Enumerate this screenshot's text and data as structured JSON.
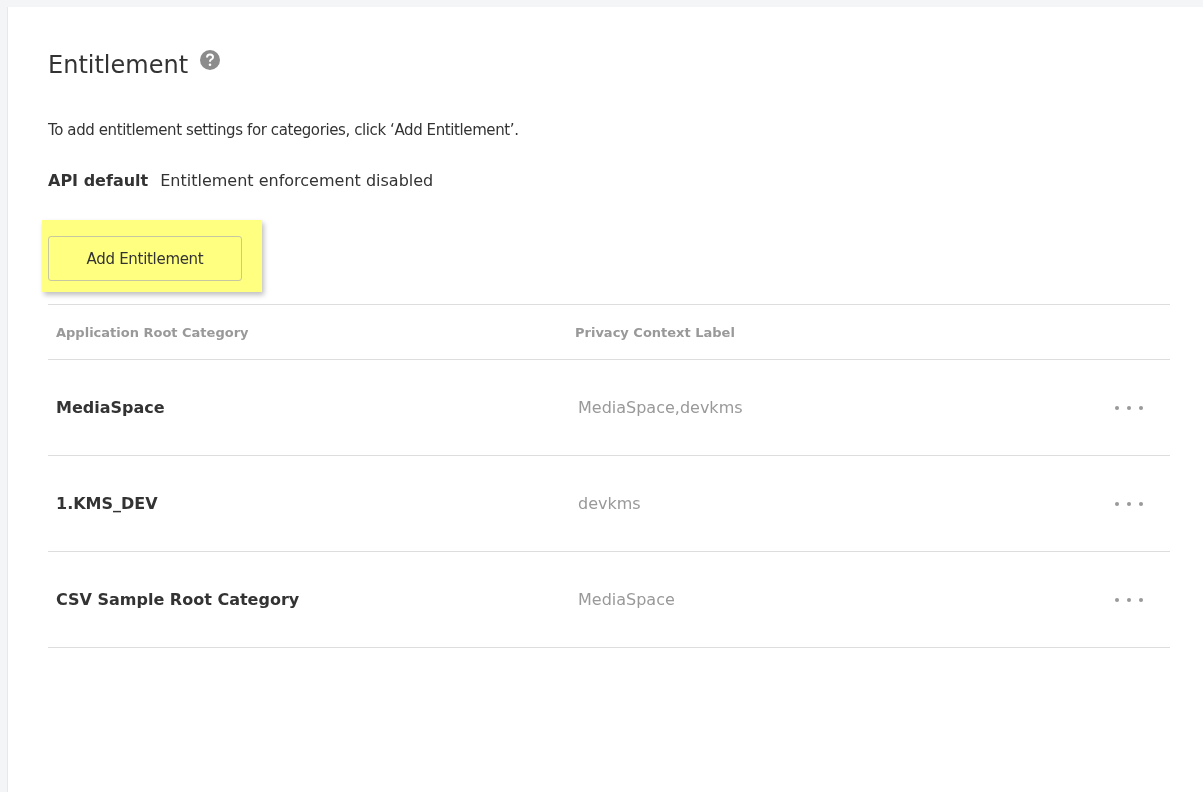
{
  "title": "Entitlement",
  "intro": "To add entitlement settings for categories, click ‘Add Entitlement’.",
  "api_default": {
    "label": "API default",
    "value": "Entitlement enforcement disabled"
  },
  "add_button": {
    "label": "Add Entitlement",
    "highlighted": true
  },
  "table": {
    "columns": [
      "Application Root Category",
      "Privacy Context Label"
    ],
    "rows": [
      {
        "category": "MediaSpace",
        "label": "MediaSpace,devkms"
      },
      {
        "category": "1.KMS_DEV",
        "label": "devkms"
      },
      {
        "category": "CSV Sample Root Category",
        "label": "MediaSpace"
      }
    ]
  }
}
